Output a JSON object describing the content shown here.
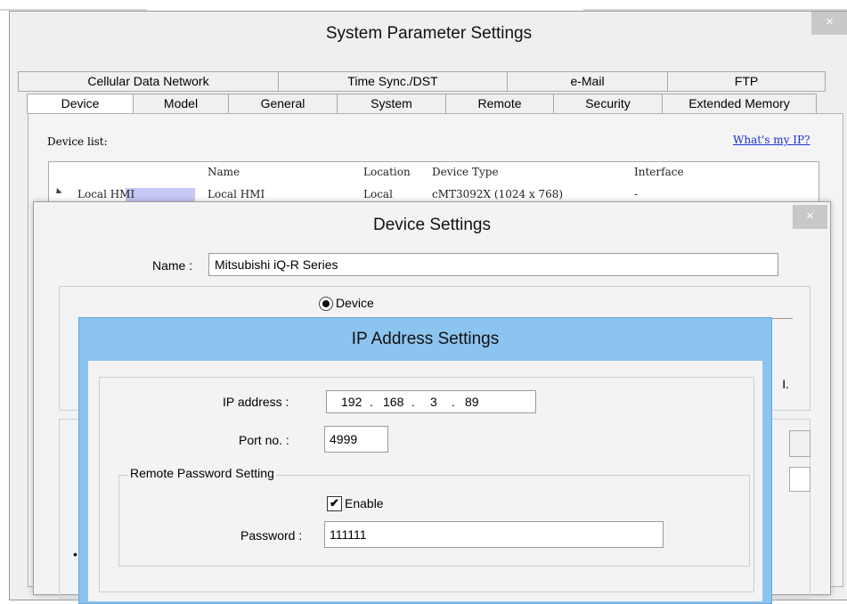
{
  "system_window": {
    "title": "System Parameter Settings",
    "close_glyph": "×",
    "tabs_row1": [
      "Cellular Data Network",
      "Time Sync./DST",
      "e-Mail",
      "FTP"
    ],
    "tabs_row2": [
      "Device",
      "Model",
      "General",
      "System",
      "Remote",
      "Security",
      "Extended Memory"
    ],
    "active_tab": "Device",
    "device_list_label": "Device list:",
    "whats_my_ip_link": "What's my IP?",
    "list_headers": [
      "Name",
      "Location",
      "Device Type",
      "Interface"
    ],
    "list_row": {
      "cell0": "Local HMI",
      "name": "Local HMI",
      "location": "Local",
      "device_type": "cMT3092X (1024 x 768)",
      "interface": "-"
    }
  },
  "device_dialog": {
    "title": "Device Settings",
    "close_glyph": "×",
    "name_label": "Name :",
    "name_value": "Mitsubishi iQ-R Series",
    "radio_label": "Device",
    "clipped_text": "I."
  },
  "ip_dialog": {
    "title": "IP Address Settings",
    "ip_label": "IP address :",
    "ip_octets": [
      "192",
      "168",
      "3",
      "89"
    ],
    "dot": ".",
    "port_label": "Port no. :",
    "port_value": "4999",
    "password_group": "Remote Password Setting",
    "enable_label": "Enable",
    "enable_checked": true,
    "check_glyph": "✔",
    "password_label": "Password :",
    "password_value": "111111"
  },
  "colors": {
    "ip_dialog_frame": "#8cc4f0",
    "selection": "#c6c7f4",
    "link": "#1a2fd6"
  }
}
